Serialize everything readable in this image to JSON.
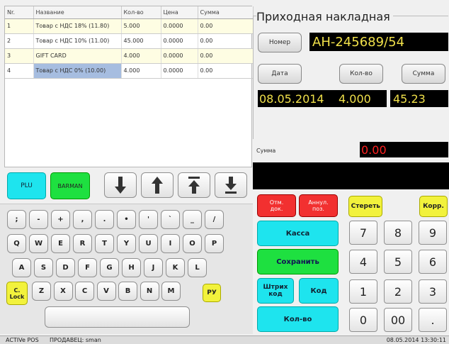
{
  "table": {
    "headers": [
      "Nr.",
      "Название",
      "Кол-во",
      "Цена",
      "Сумма"
    ],
    "rows": [
      [
        "1",
        "Товар с НДС 18% (11.80)",
        "5.000",
        "0.0000",
        "0.00"
      ],
      [
        "2",
        "Товар с НДС 10% (11.00)",
        "45.000",
        "0.0000",
        "0.00"
      ],
      [
        "3",
        "GIFT CARD",
        "4.000",
        "0.0000",
        "0.00"
      ],
      [
        "4",
        "Товар с НДС 0% (10.00)",
        "4.000",
        "0.0000",
        "0.00"
      ]
    ]
  },
  "invoice": {
    "title": "Приходная накладная",
    "number_label": "Номер",
    "number_value": "АН-245689/54",
    "date_label": "Дата",
    "qty_label": "Кол-во",
    "sum_label": "Сумма",
    "date_value": "08.05.2014",
    "qty_value": "4.000",
    "sum_value": "45.23",
    "total_label": "Сумма",
    "total_value": "0.00"
  },
  "toolbar": {
    "plu": "PLU",
    "barman": "BARMAN"
  },
  "keyboard": {
    "row1": [
      ";",
      "-",
      "+",
      ",",
      ".",
      "•",
      "'",
      "`",
      "_",
      "/"
    ],
    "row2": [
      "Q",
      "W",
      "E",
      "R",
      "T",
      "Y",
      "U",
      "I",
      "O",
      "P"
    ],
    "row3": [
      "A",
      "S",
      "D",
      "F",
      "G",
      "H",
      "J",
      "K",
      "L"
    ],
    "row4": [
      "Z",
      "X",
      "C",
      "V",
      "B",
      "N",
      "M"
    ],
    "caps": "C.\nLock",
    "lang": "РУ"
  },
  "actions": {
    "cancel_doc": "Отм.\nдок.",
    "annul_pos": "Аннул.\nпоз.",
    "erase": "Стереть",
    "corr": "Корр.",
    "kassa": "Касса",
    "save": "Сохранить",
    "barcode": "Штрих\nкод",
    "code": "Код",
    "qty": "Кол-во"
  },
  "numpad": [
    "7",
    "8",
    "9",
    "4",
    "5",
    "6",
    "1",
    "2",
    "3",
    "0",
    "00",
    "."
  ],
  "status": {
    "app": "ACTIVe POS",
    "seller": "ПРОДАВЕЦ: sman",
    "datetime": "08.05.2014 13:30:11"
  },
  "colors": {
    "cyan": "#1ee4ee",
    "green": "#1ee040",
    "red": "#f23030",
    "yellow": "#f2f23c",
    "display_text": "#f0e04a",
    "total_text": "#ff2020"
  }
}
